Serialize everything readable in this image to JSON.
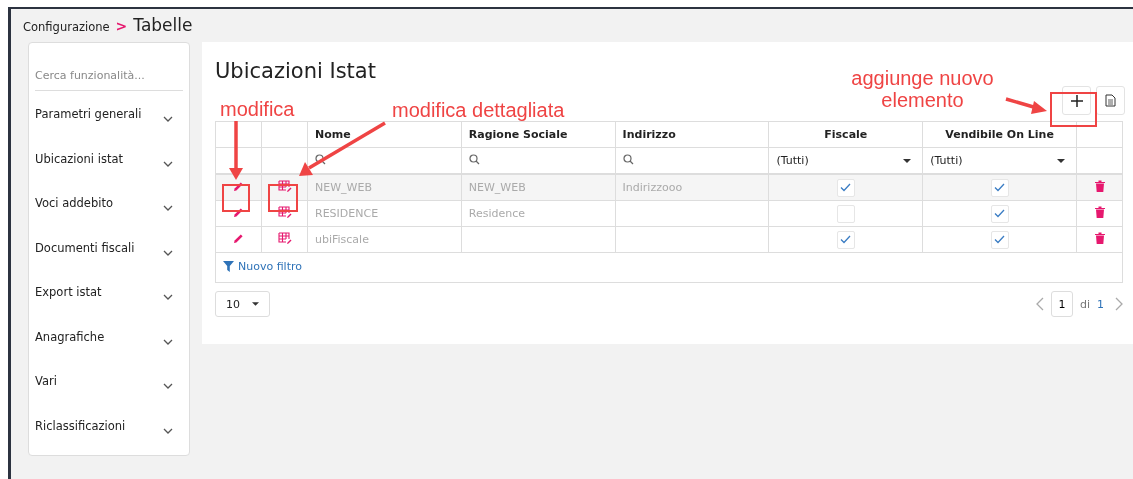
{
  "breadcrumb": {
    "parent": "Configurazione",
    "separator": ">",
    "current": "Tabelle"
  },
  "sidebar": {
    "search": {
      "placeholder": "Cerca funzionalità..."
    },
    "items": [
      {
        "label": "Parametri generali",
        "expanded": false
      },
      {
        "label": "Ubicazioni istat",
        "expanded": false
      },
      {
        "label": "Voci addebito",
        "expanded": false
      },
      {
        "label": "Documenti fiscali",
        "expanded": false
      },
      {
        "label": "Export istat",
        "expanded": false
      },
      {
        "label": "Anagrafiche",
        "expanded": false
      },
      {
        "label": "Vari",
        "expanded": false
      },
      {
        "label": "Riclassificazioni",
        "expanded": false
      }
    ]
  },
  "panel": {
    "title": "Ubicazioni Istat"
  },
  "table": {
    "columns": [
      {
        "label": "Nome",
        "kind": "text"
      },
      {
        "label": "Ragione Sociale",
        "kind": "text"
      },
      {
        "label": "Indirizzo",
        "kind": "text"
      },
      {
        "label": "Fiscale",
        "kind": "check"
      },
      {
        "label": "Vendibile On Line",
        "kind": "check"
      }
    ],
    "filters": [
      {
        "kind": "search"
      },
      {
        "kind": "search"
      },
      {
        "kind": "search"
      },
      {
        "kind": "select",
        "value": "(Tutti)"
      },
      {
        "kind": "select",
        "value": "(Tutti)"
      }
    ],
    "rows": [
      {
        "cells": [
          "NEW_WEB",
          "NEW_WEB",
          "Indirizzooo"
        ],
        "fiscale": true,
        "vendibile_on_line": true
      },
      {
        "cells": [
          "RESIDENCE",
          "Residence",
          ""
        ],
        "fiscale": false,
        "vendibile_on_line": true
      },
      {
        "cells": [
          "ubiFiscale",
          "",
          ""
        ],
        "fiscale": true,
        "vendibile_on_line": true
      }
    ],
    "new_filter": "Nuovo filtro"
  },
  "pager": {
    "page_size": "10",
    "page": "1",
    "of_label": "di",
    "total": "1"
  },
  "annotations": [
    {
      "text": "modifica"
    },
    {
      "text": "modifica dettagliata"
    },
    {
      "text": "aggiunge nuovo elemento"
    }
  ]
}
